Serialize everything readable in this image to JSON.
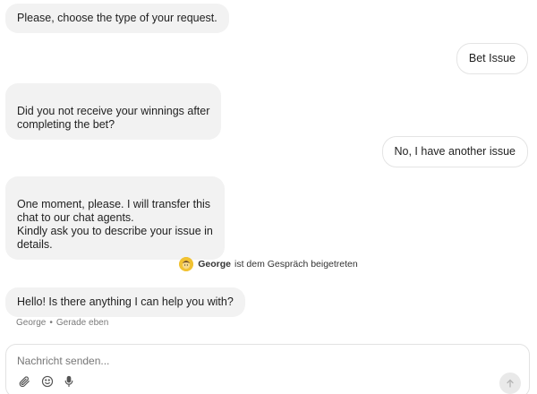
{
  "messages": [
    {
      "sender": "bot",
      "text": "Please, choose the type of your request."
    },
    {
      "sender": "user",
      "text": "Bet Issue"
    },
    {
      "sender": "bot",
      "text": "Did you not receive your winnings after\ncompleting the bet?"
    },
    {
      "sender": "user",
      "text": "No, I have another issue"
    },
    {
      "sender": "bot",
      "text": "One moment, please. I will transfer this\nchat to our chat agents.\nKindly ask you to describe your issue in\ndetails."
    },
    {
      "sender": "agent",
      "text": "Hello! Is there anything I can help you with?"
    }
  ],
  "join_notice": {
    "agent_name": "George",
    "text": "ist dem Gespräch beigetreten",
    "avatar_icon": "agent-avatar-icon"
  },
  "last_meta": {
    "author": "George",
    "separator": "•",
    "time": "Gerade eben"
  },
  "composer": {
    "placeholder": "Nachricht senden...",
    "icons": [
      "paperclip-icon",
      "emoji-icon",
      "microphone-icon",
      "send-arrow-icon"
    ]
  },
  "colors": {
    "bot_bubble": "#f2f2f2",
    "user_bubble_border": "#e4e4e4",
    "avatar": "#f1c232",
    "send_button": "#e9e9e9"
  }
}
